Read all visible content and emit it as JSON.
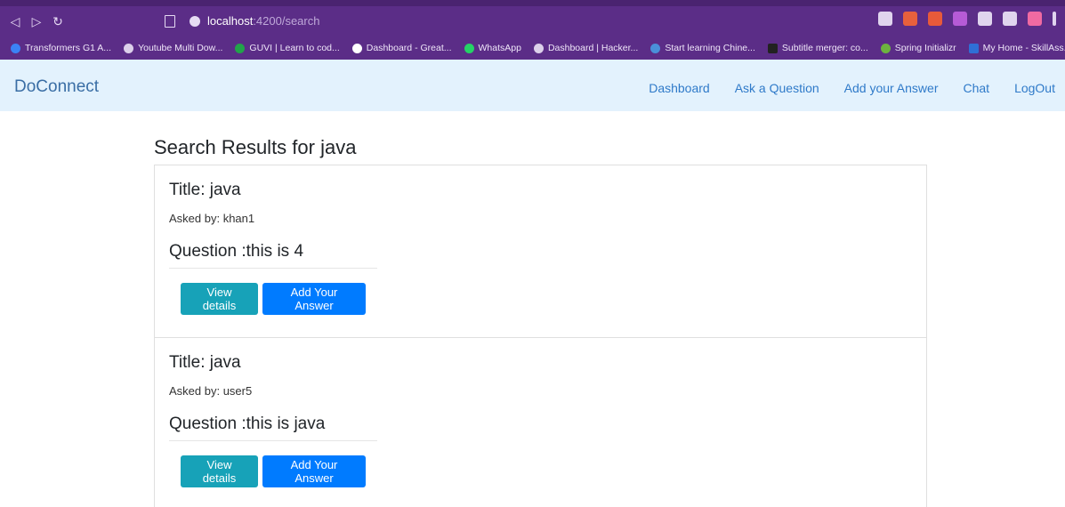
{
  "browser": {
    "url_host": "localhost",
    "url_path": ":4200/search",
    "bookmarks": [
      "Transformers G1 A...",
      "Youtube Multi Dow...",
      "GUVI | Learn to cod...",
      "Dashboard - Great...",
      "WhatsApp",
      "Dashboard | Hacker...",
      "Start learning Chine...",
      "Subtitle merger: co...",
      "Spring Initializr",
      "My Home - SkillAss..."
    ]
  },
  "navbar": {
    "brand": "DoConnect",
    "links": [
      "Dashboard",
      "Ask a Question",
      "Add your Answer",
      "Chat",
      "LogOut"
    ]
  },
  "page": {
    "title": "Search Results for java"
  },
  "results": [
    {
      "title": "Title: java",
      "asked_by": "Asked by: khan1",
      "question": "Question :this is 4",
      "view_label": "View details",
      "answer_label": "Add Your Answer"
    },
    {
      "title": "Title: java",
      "asked_by": "Asked by: user5",
      "question": "Question :this is java",
      "view_label": "View details",
      "answer_label": "Add Your Answer"
    }
  ],
  "colors": {
    "chrome": "#5b2d87",
    "navbar_bg": "#e3f2fd",
    "btn_info": "#17a2b8",
    "btn_primary": "#007bff"
  }
}
